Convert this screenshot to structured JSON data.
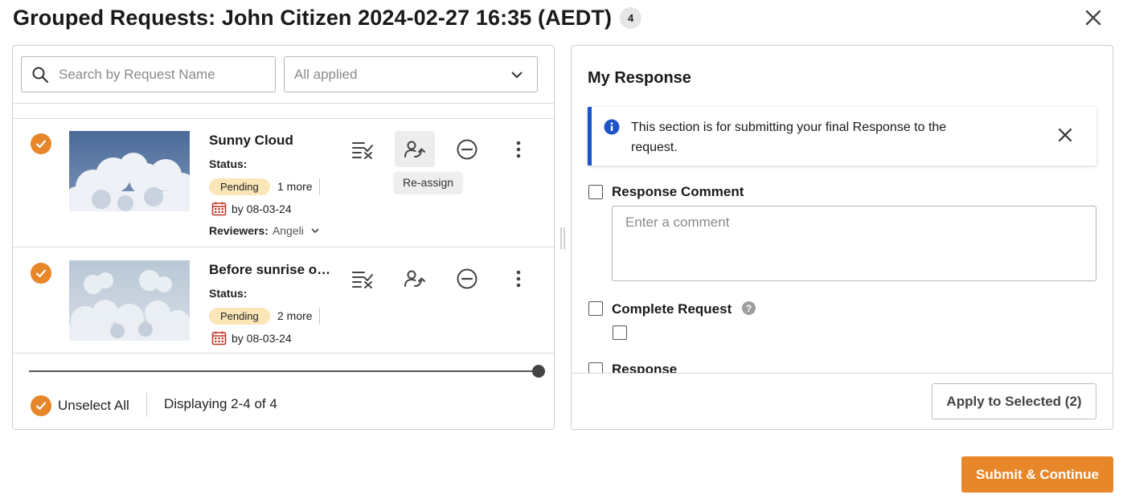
{
  "header": {
    "title": "Grouped Requests: John Citizen 2024-02-27 16:35 (AEDT)",
    "count_badge": "4",
    "close_icon": "close-icon"
  },
  "list_panel": {
    "search": {
      "placeholder": "Search by Request Name",
      "value": ""
    },
    "filter": {
      "selected": "All applied"
    },
    "requests": [
      {
        "name": "Sunny Cloud",
        "status_label": "Status:",
        "status": "Pending",
        "more": "1 more",
        "due": "by 08-03-24",
        "reviewers_label": "Reviewers:",
        "reviewers": "Angeli",
        "selected": true
      },
      {
        "name": "Before sunrise on a cloudy morning",
        "status_label": "Status:",
        "status": "Pending",
        "more": "2 more",
        "due": "by 08-03-24",
        "selected": true
      }
    ],
    "tooltip": "Re-assign",
    "scroll_position": 1.0,
    "footer": {
      "unselect_all": "Unselect All",
      "displaying": "Displaying 2-4 of 4"
    }
  },
  "response_panel": {
    "title": "My Response",
    "info_message": "This section is for submitting your final Response to the request.",
    "fields": {
      "response_comment_label": "Response Comment",
      "comment_placeholder": "Enter a comment",
      "complete_request_label": "Complete Request",
      "help_glyph": "?",
      "response_label": "Response"
    },
    "apply_button": "Apply to Selected (2)"
  },
  "footer": {
    "submit_button": "Submit & Continue"
  },
  "colors": {
    "accent": "#e8862a",
    "pending_pill": "#fbe6b8",
    "info_border": "#1b55c9",
    "calendar": "#c0392b"
  }
}
